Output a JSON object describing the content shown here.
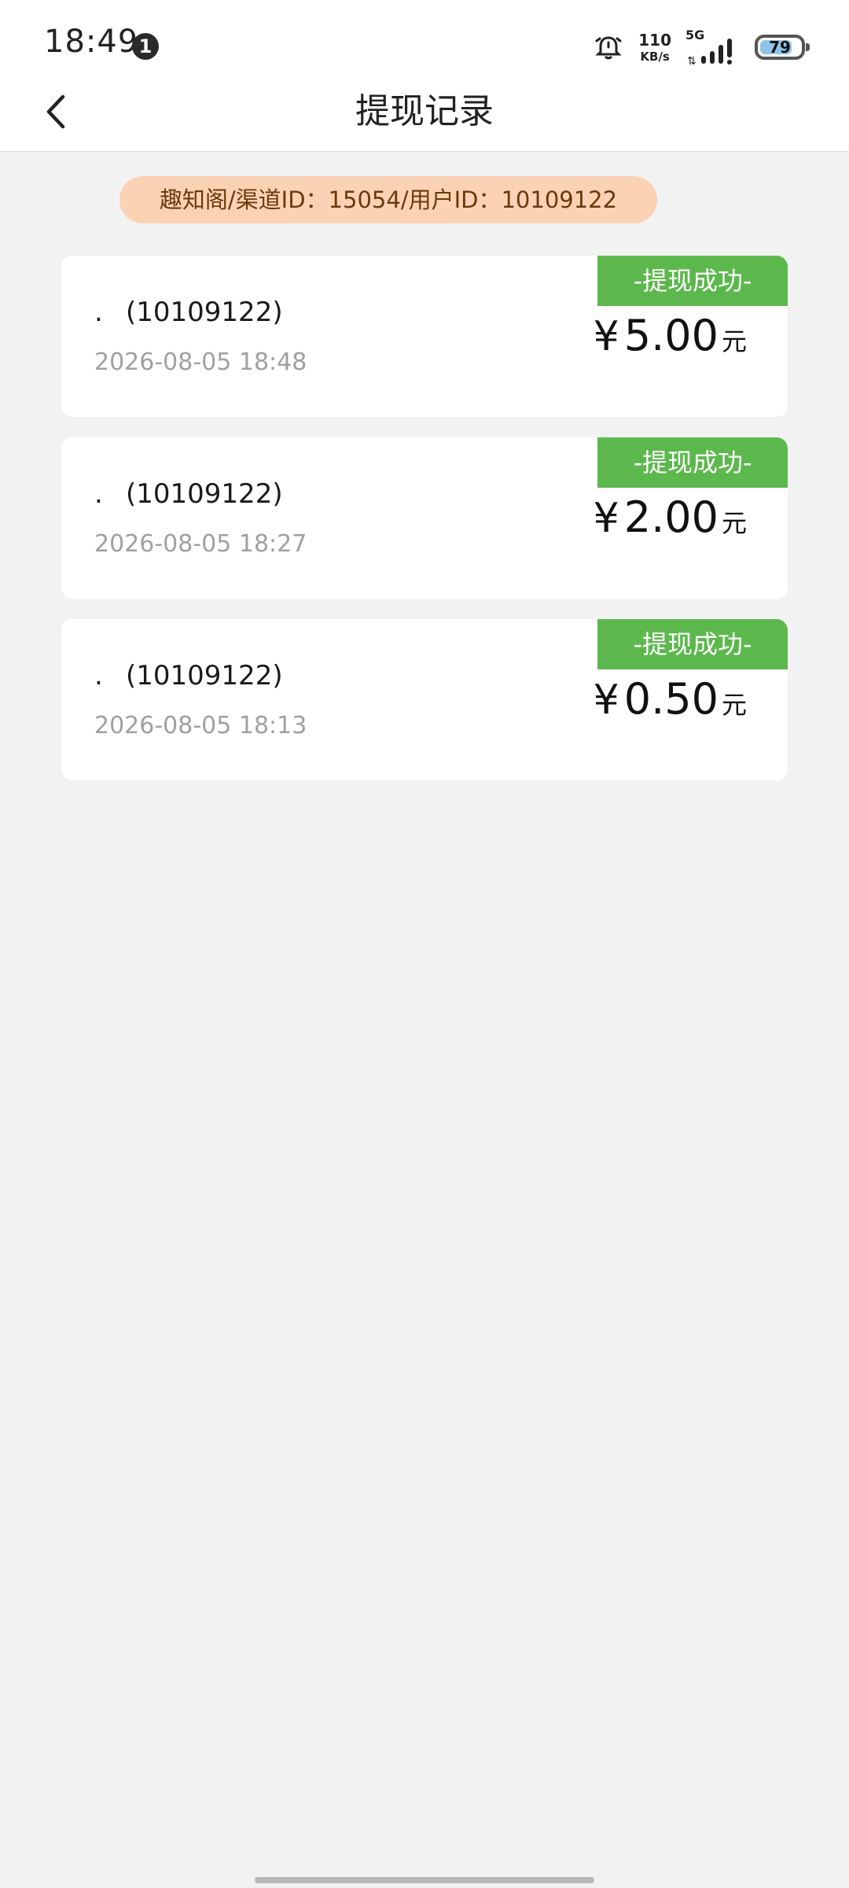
{
  "status_bar": {
    "time": "18:49",
    "notification_count": "1",
    "net_speed_value": "110",
    "net_speed_unit": "KB/s",
    "network_type": "5G",
    "battery_level": 79,
    "battery_label": "79"
  },
  "header": {
    "title": "提现记录"
  },
  "info_pill": {
    "text": "趣知阁/渠道ID：15054/用户ID：10109122"
  },
  "records": [
    {
      "bullet": ".",
      "name": "(10109122)",
      "time": "2026-08-05 18:48",
      "status": "-提现成功-",
      "currency": "¥",
      "amount": "5.00",
      "unit": "元"
    },
    {
      "bullet": ".",
      "name": "(10109122)",
      "time": "2026-08-05 18:27",
      "status": "-提现成功-",
      "currency": "¥",
      "amount": "2.00",
      "unit": "元"
    },
    {
      "bullet": ".",
      "name": "(10109122)",
      "time": "2026-08-05 18:13",
      "status": "-提现成功-",
      "currency": "¥",
      "amount": "0.50",
      "unit": "元"
    }
  ],
  "colors": {
    "success_green": "#5cb84d",
    "pill_bg": "#fcd2b4",
    "pill_text": "#6a3a0c",
    "page_bg": "#f2f2f2"
  }
}
